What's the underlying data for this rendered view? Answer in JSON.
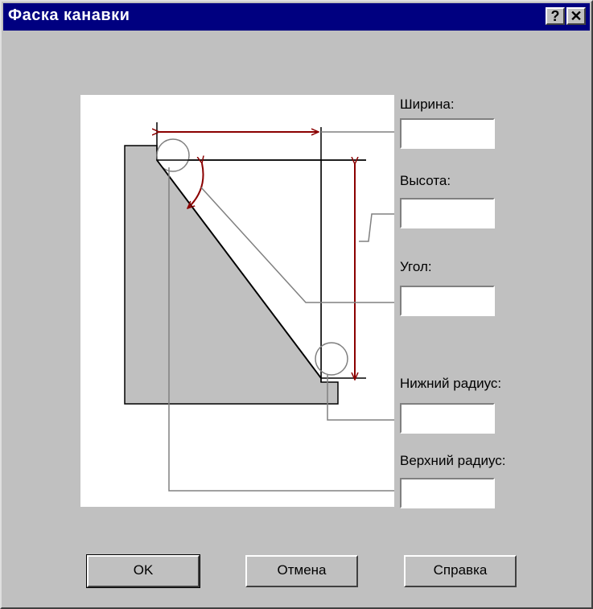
{
  "window": {
    "title": "Фаска канавки"
  },
  "titlebar_buttons": {
    "help": "?",
    "close": "✕"
  },
  "fields": {
    "width_label": "Ширина:",
    "width_value": "",
    "height_label": "Высота:",
    "height_value": "",
    "angle_label": "Угол:",
    "angle_value": "",
    "bottom_radius_label": "Нижний радиус:",
    "bottom_radius_value": "",
    "top_radius_label": "Верхний радиус:",
    "top_radius_value": ""
  },
  "buttons": {
    "ok": "OK",
    "cancel": "Отмена",
    "help": "Справка"
  },
  "colors": {
    "dimension": "#8b0000",
    "part_fill": "#c0c0c0",
    "leader": "#808080"
  }
}
